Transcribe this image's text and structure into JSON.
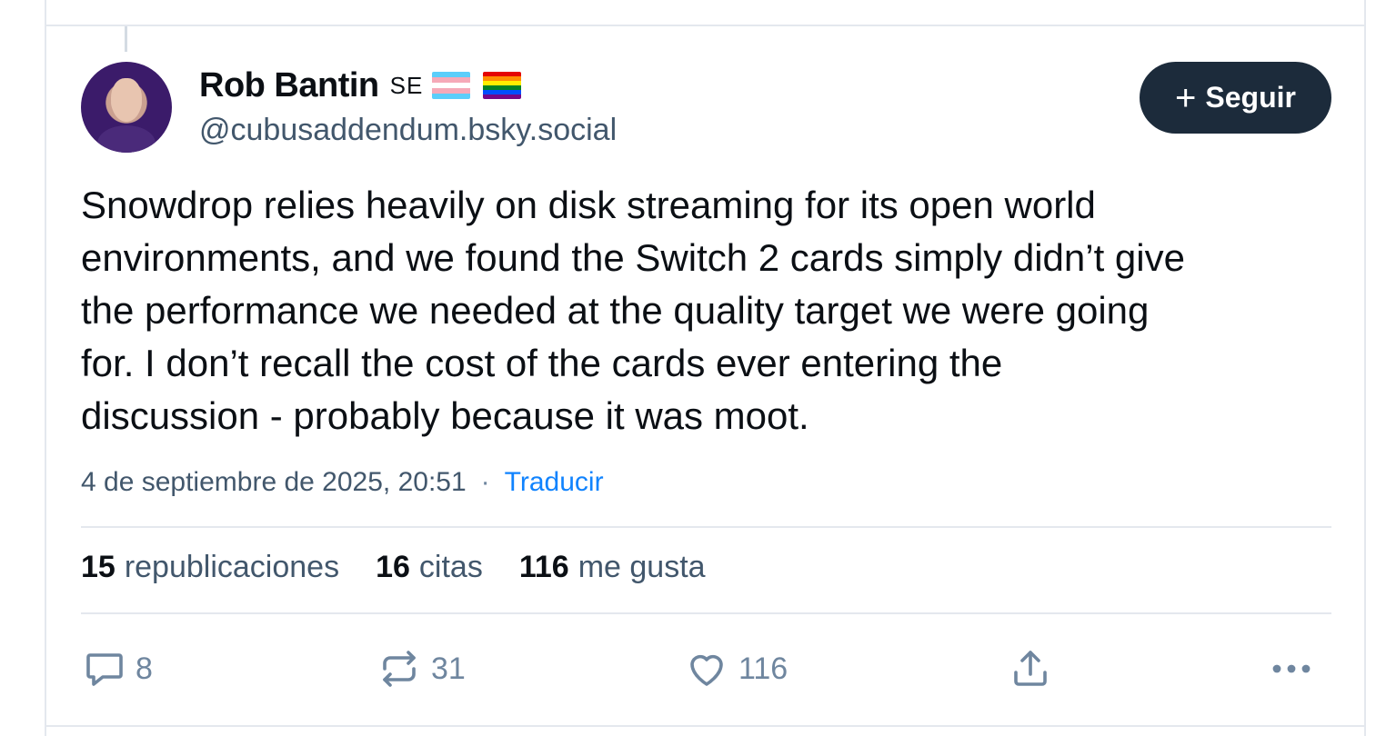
{
  "post": {
    "author_name": "Rob Bantin",
    "pronoun_badge": "SE",
    "handle": "@cubusaddendum.bsky.social",
    "follow_label": "Seguir",
    "text_lines": [
      "Snowdrop relies heavily on disk streaming for its open world",
      "environments, and we found the Switch 2 cards simply didn’t give",
      "the performance we needed at the quality target we were going",
      "for. I don’t recall the cost of the cards ever entering the",
      "discussion - probably because it was moot."
    ],
    "timestamp": "4 de septiembre de 2025, 20:51",
    "separator": "·",
    "translate_label": "Traducir"
  },
  "stats": {
    "reposts_count": "15",
    "reposts_label": "republicaciones",
    "quotes_count": "16",
    "quotes_label": "citas",
    "likes_count": "116",
    "likes_label": "me gusta"
  },
  "actions": {
    "reply_count": "8",
    "repost_count": "31",
    "like_count": "116"
  },
  "icons": {
    "reply": "reply-icon",
    "repost": "repost-icon",
    "like": "heart-icon",
    "share": "share-icon",
    "more": "more-icon"
  },
  "colors": {
    "follow_button_bg": "#1c2b3b",
    "link": "#1083fe",
    "muted_text": "#42576c",
    "icon": "#6f869f"
  }
}
